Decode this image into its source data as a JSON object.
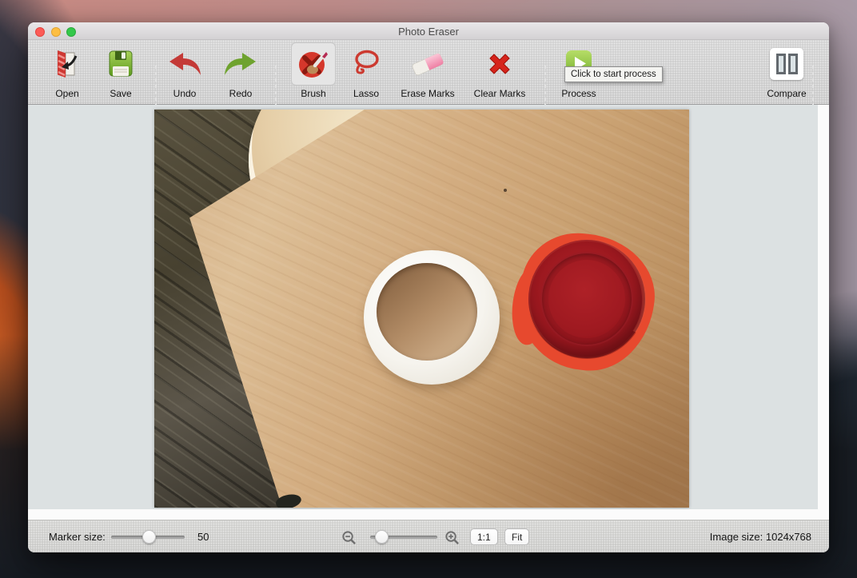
{
  "window": {
    "title": "Photo Eraser"
  },
  "toolbar": {
    "items": [
      {
        "label": "Open"
      },
      {
        "label": "Save"
      },
      {
        "label": "Undo"
      },
      {
        "label": "Redo"
      },
      {
        "label": "Brush",
        "selected": true
      },
      {
        "label": "Lasso"
      },
      {
        "label": "Erase Marks"
      },
      {
        "label": "Clear Marks"
      },
      {
        "label": "Process"
      },
      {
        "label": "Compare"
      }
    ],
    "process_tooltip": "Click to start process"
  },
  "statusbar": {
    "marker_size_label": "Marker size:",
    "marker_size_value": "50",
    "actual_size_button": "1:1",
    "fit_button": "Fit",
    "image_size": "Image size: 1024x768"
  },
  "colors": {
    "mark_red": "#e7492e",
    "lid_dark_red": "#9a161d",
    "toolbar_bg": "#d3d3d3",
    "canvas_bg": "#dce1e2"
  }
}
